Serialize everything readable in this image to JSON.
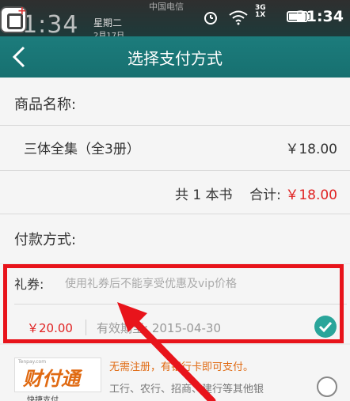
{
  "status_bar": {
    "clock_big": "21:34",
    "weekday": "星期二",
    "date": "2月17日",
    "carrier": "中国电信 ",
    "network": [
      "3G",
      "1X"
    ],
    "time": "21:34"
  },
  "title_bar": {
    "back_icon": "chevron-left-icon",
    "title": "选择支付方式"
  },
  "product": {
    "label": "商品名称:",
    "name": "三体全集（全3册）",
    "price": "￥18.00"
  },
  "summary": {
    "count_text": "共 1 本书",
    "total_label": "合计:",
    "total_amount": "￥18.00"
  },
  "payment": {
    "label": "付款方式:"
  },
  "coupon": {
    "label": "礼券:",
    "hint": "使用礼券后不能享受优惠及vip价格",
    "value": "￥20.00",
    "expiry": "有效期至: 2015-04-30",
    "selected": true
  },
  "tenpay": {
    "logo": "财付通",
    "logo_tag": "Tenpay.com",
    "sub": "快捷支付",
    "promo": "无需注册，有银行卡即可支付。",
    "desc": "工行、农行、招商、建行等其他银",
    "selected": false
  },
  "colors": {
    "accent": "#177070",
    "price_red": "#e02222",
    "annotation_red": "#e8141b",
    "check_teal": "#2aa59a",
    "tenpay_orange": "#e06a12"
  }
}
